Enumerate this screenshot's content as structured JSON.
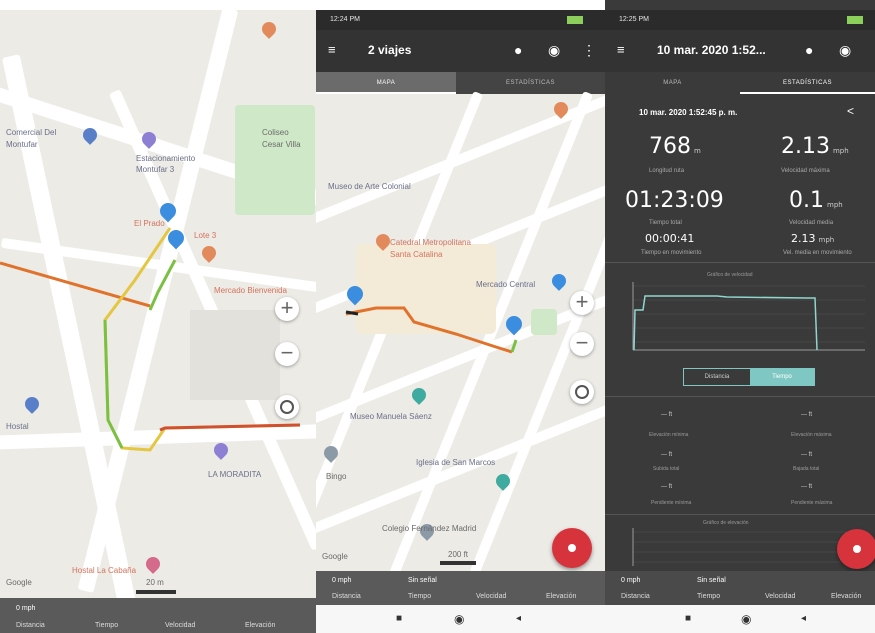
{
  "screens": {
    "left": {
      "map_labels": {
        "comercial": "Comercial Del",
        "montufar": "Montufar",
        "estacionamiento": "Estacionamiento",
        "montufar3": "Montufar 3",
        "colisseo": "Coliseo",
        "cesar": "Cesar Villa",
        "el_prado": "El Prado",
        "lote": "Lote 3",
        "mercado_bienvenida": "Mercado Bienvenida",
        "la_moradita": "LA MORADITA",
        "hostal_cabana": "Hostal La Cabaña",
        "hostal": "Hostal",
        "scale": "20 m",
        "google": "Google"
      },
      "bottom": {
        "value": "0 mph",
        "captions": [
          "Distancia",
          "Tiempo",
          "Velocidad",
          "Elevación"
        ]
      }
    },
    "middle": {
      "status_time": "12:24 PM",
      "title": "2 viajes",
      "tabs": {
        "map": "MAPA",
        "stats": "ESTADÍSTICAS"
      },
      "map_labels": {
        "museo": "Museo de Arte Colonial",
        "santa_catalina": "Santa Catalina",
        "catedral": "Catedral Metropolitana",
        "mercado_central": "Mercado Central",
        "museo_manuela": "Museo Manuela Sáenz",
        "iglesia": "Iglesia de San Marcos",
        "colegio": "Colegio Fernández Madrid",
        "bingo": "Bingo",
        "scale": "200 ft",
        "google": "Google"
      },
      "bottom": {
        "value1": "0 mph",
        "value2": "Sin señal",
        "captions": [
          "Distancia",
          "Tiempo",
          "Velocidad",
          "Elevación"
        ]
      }
    },
    "right": {
      "status_time": "12:25 PM",
      "title": "10 mar. 2020 1:52...",
      "tabs": {
        "map": "MAPA",
        "stats": "ESTADÍSTICAS"
      },
      "header": "10 mar. 2020 1:52:45 p. m.",
      "stats": {
        "distance": "768",
        "distance_unit": "m",
        "distance_caption": "Longitud ruta",
        "max_speed": "2.13",
        "max_speed_unit": "mph",
        "max_speed_caption": "Velocidad máxima",
        "total_time": "01:23:09",
        "total_time_caption": "Tiempo total",
        "avg_speed": "0.1",
        "avg_speed_unit": "mph",
        "avg_speed_caption": "Velocidad media",
        "moving_time": "00:00:41",
        "moving_time_caption": "Tiempo en movimiento",
        "moving_speed": "2.13",
        "moving_speed_unit": "mph",
        "moving_speed_caption": "Vel. media en movimiento"
      },
      "chart_title": "Gráfico de velocidad",
      "segment": {
        "left": "Distancia",
        "right": "Tiempo"
      },
      "elevation_rows": [
        {
          "left": "— ft",
          "right": "— ft"
        },
        {
          "left": "— ft",
          "right": "— ft"
        },
        {
          "left": "— ft",
          "right": "— ft"
        }
      ],
      "elevation_captions": [
        "Elevación mínima",
        "Elevación máxima",
        "Subida total",
        "Bajada total",
        "Pendiente mínima",
        "Pendiente máxima"
      ],
      "chart2_title": "Gráfico de elevación",
      "bottom": {
        "value1": "0 mph",
        "value2": "Sin señal",
        "captions": [
          "Distancia",
          "Tiempo",
          "Velocidad",
          "Elevación"
        ]
      }
    }
  },
  "colors": {
    "route_orange": "#e0722b",
    "route_green": "#7ac143",
    "route_yellow": "#e5c640",
    "pin_blue": "#3b8de0",
    "fab_red": "#d7333c",
    "appbar": "#333333",
    "stats_bg": "#3a3a3a",
    "accent_teal": "#7fc7c3"
  }
}
